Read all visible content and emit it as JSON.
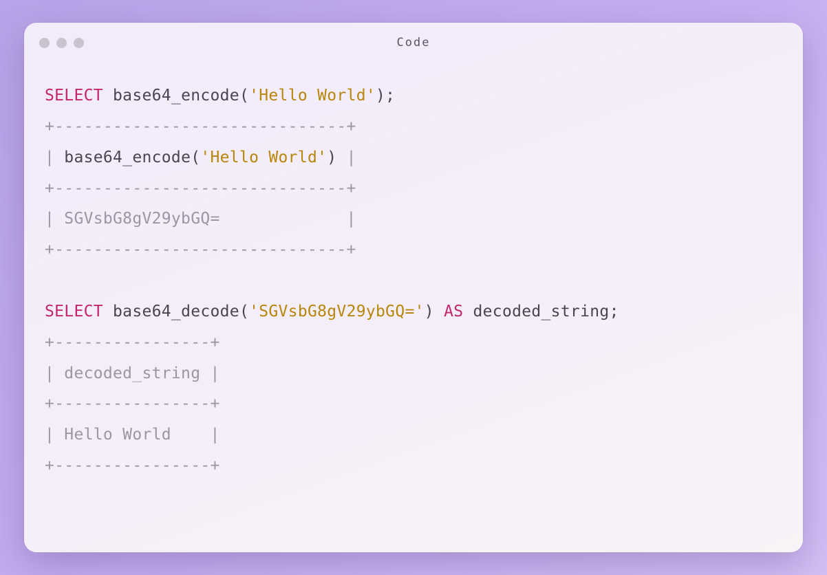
{
  "window": {
    "title": "Code"
  },
  "code": {
    "line1_kw": "SELECT",
    "line1_fn": " base64_encode(",
    "line1_str": "'Hello World'",
    "line1_end": ");",
    "tbl1_border": "+------------------------------+",
    "tbl1_h_open": "| ",
    "tbl1_h_fn": "base64_encode(",
    "tbl1_h_str": "'Hello World'",
    "tbl1_h_close": ")",
    "tbl1_h_end": " |",
    "tbl1_row": "| SGVsbG8gV29ybGQ=             |",
    "blank": "",
    "line2_kw1": "SELECT",
    "line2_fn": " base64_decode(",
    "line2_str": "'SGVsbG8gV29ybGQ='",
    "line2_close": ") ",
    "line2_kw2": "AS",
    "line2_alias": " decoded_string;",
    "tbl2_border": "+----------------+",
    "tbl2_header": "| decoded_string |",
    "tbl2_row": "| Hello World    |"
  }
}
